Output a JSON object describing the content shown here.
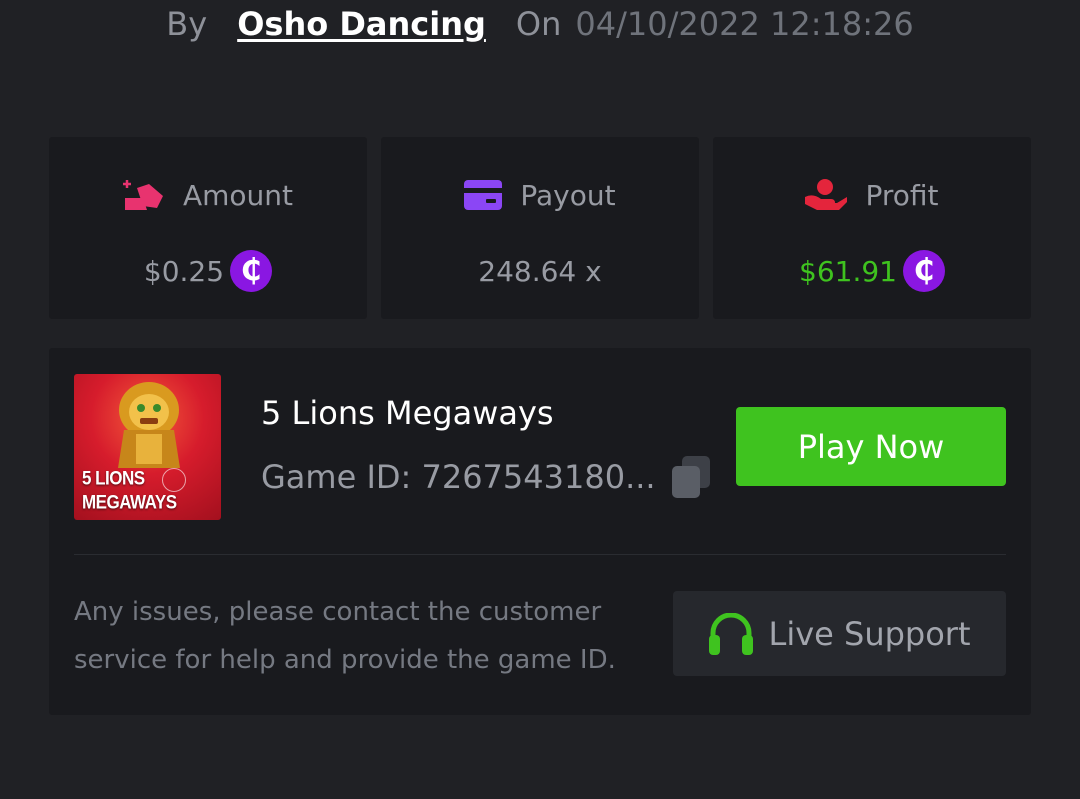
{
  "header": {
    "by_label": "By",
    "author": "Osho Dancing",
    "on_label": "On",
    "timestamp": "04/10/2022 12:18:26"
  },
  "stats": {
    "amount": {
      "label": "Amount",
      "value": "$0.25",
      "icon": "bet-chips-icon",
      "icon_color": "#e8336f"
    },
    "payout": {
      "label": "Payout",
      "value": "248.64 x",
      "icon": "credit-card-icon",
      "icon_color": "#8b46f5"
    },
    "profit": {
      "label": "Profit",
      "value": "$61.91",
      "icon": "hand-money-icon",
      "icon_color": "#e4253c",
      "value_color": "#3fc31f"
    }
  },
  "currency": {
    "symbol": "₵",
    "color": "#8a17e2"
  },
  "game": {
    "thumb_title_line1": "5 LIONS",
    "thumb_title_line2": "MEGAWAYS",
    "name": "5 Lions Megaways",
    "id_text": "Game ID: 7267543180...",
    "play_label": "Play Now"
  },
  "support": {
    "help_text": "Any issues, please contact the customer service for help and provide the game ID.",
    "button_label": "Live Support",
    "icon": "headset-icon"
  },
  "colors": {
    "background": "#202125",
    "card": "#191a1e",
    "accent_green": "#3fc31f"
  }
}
